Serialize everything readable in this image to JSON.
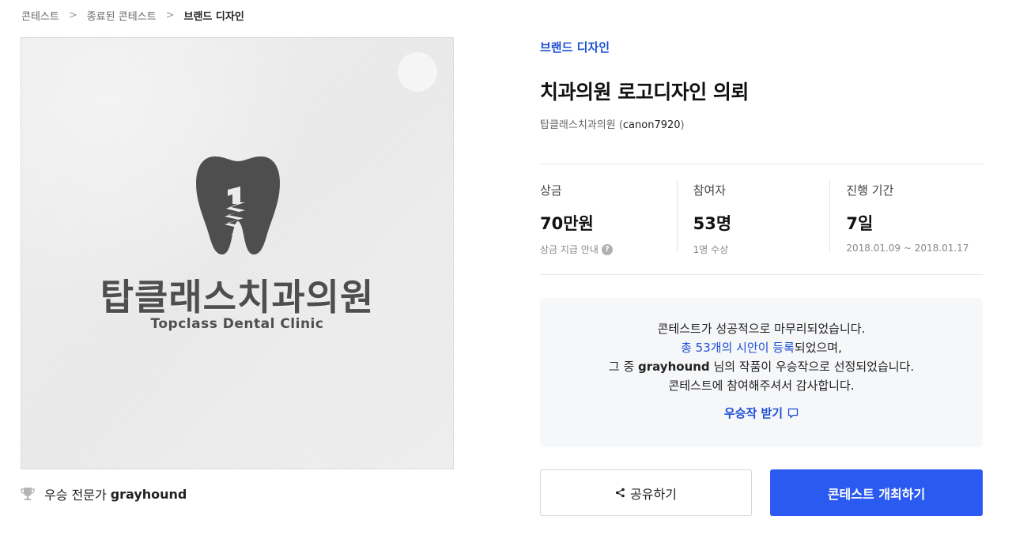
{
  "breadcrumb": {
    "items": [
      "콘테스트",
      "종료된 콘테스트",
      "브랜드 디자인"
    ],
    "separator": ">"
  },
  "hero": {
    "logo_korean": "탑클래스치과의원",
    "logo_english": "Topclass Dental Clinic",
    "logo_color": "#4e4e4e"
  },
  "winner": {
    "icon": "trophy-icon",
    "label": "우승 전문가",
    "name": "grayhound"
  },
  "contest": {
    "category": "브랜드 디자인",
    "title": "치과의원 로고디자인 의뢰",
    "host_name": "탑클래스치과의원",
    "host_id": "canon7920",
    "host_paren_open": "(",
    "host_paren_close": ")"
  },
  "stats": [
    {
      "label": "상금",
      "value": "70만원",
      "sub": "상금 지급 안내",
      "sub_icon": "help-icon"
    },
    {
      "label": "참여자",
      "value": "53명",
      "sub": "1명 수상"
    },
    {
      "label": "진행 기간",
      "value": "7일",
      "sub": "2018.01.09 ~ 2018.01.17"
    }
  ],
  "notice": {
    "line1": "콘테스트가 성공적으로 마무리되었습니다.",
    "line2_link": "총 53개의 시안이 등록",
    "line2_rest": "되었으며,",
    "line3_pre": "그 중 ",
    "line3_name": "grayhound",
    "line3_post": " 님의 작품이 우승작으로 선정되었습니다.",
    "line4": "콘테스트에 참여해주셔서 감사합니다.",
    "receive_label": "우승작 받기",
    "receive_icon": "comment-icon"
  },
  "buttons": {
    "share_label": "공유하기",
    "share_icon": "share-icon",
    "host_label": "콘테스트 개최하기"
  },
  "colors": {
    "accent": "#1f4fd6",
    "primary_button": "#2a5af0",
    "notice_bg": "#f6f7f9"
  }
}
